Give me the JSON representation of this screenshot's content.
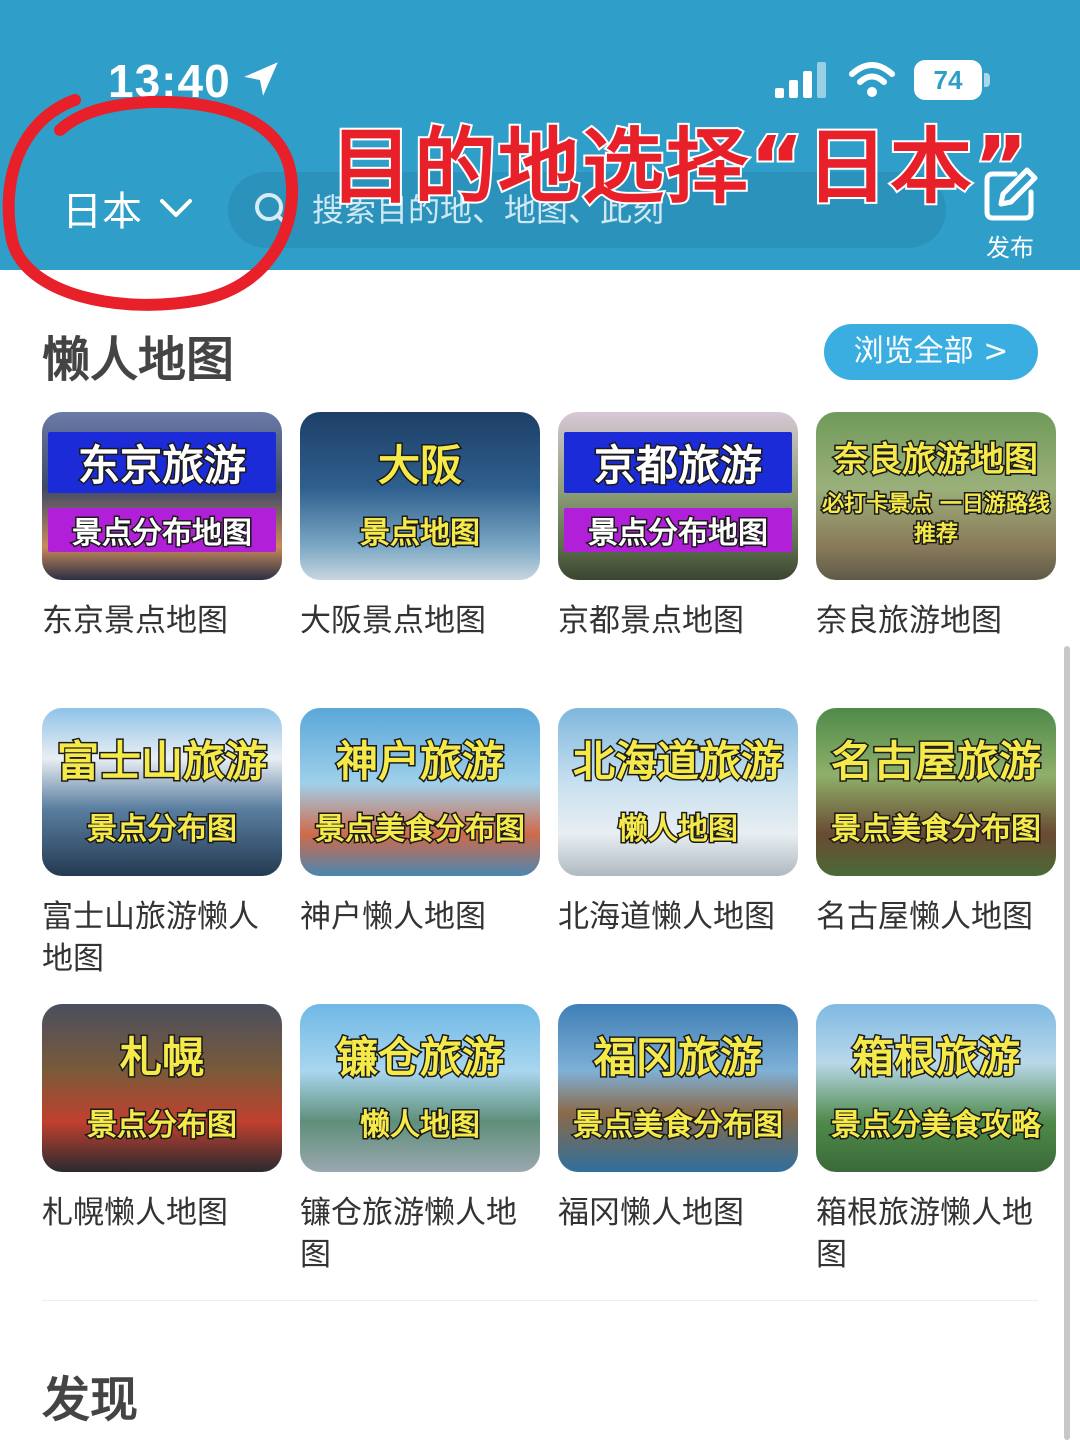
{
  "status_bar": {
    "time": "13:40",
    "battery": "74"
  },
  "annotation": {
    "title": "目的地选择“日本”",
    "highlight_color": "#e8202a"
  },
  "header": {
    "region": "日本",
    "search_placeholder": "搜索目的地、地图、此刻",
    "publish_label": "发布",
    "background": "#2f9fc9"
  },
  "section": {
    "title": "懒人地图",
    "browse_all": "浏览全部 >"
  },
  "maps": [
    {
      "label": "东京景点地图",
      "thumb_title": "东京旅游",
      "thumb_sub": "景点分布地图",
      "style": "bar",
      "bg": "linear-gradient(180deg,#6a7ba8 0%,#3e4868 45%,#c98a5a 80%,#2a2f45 100%)"
    },
    {
      "label": "大阪景点地图",
      "thumb_title": "大阪",
      "thumb_sub": "景点地图",
      "style": "plain",
      "bg": "linear-gradient(180deg,#1d3f66 0%,#2f5f8f 45%,#7ba8c4 80%,#c9d6df 100%)"
    },
    {
      "label": "京都景点地图",
      "thumb_title": "京都旅游",
      "thumb_sub": "景点分布地图",
      "style": "bar",
      "bg": "linear-gradient(180deg,#d8c8d6 0%,#8fa07a 45%,#5c6e4c 80%,#3b4430 100%)"
    },
    {
      "label": "奈良旅游地图",
      "thumb_title": "奈良旅游地图",
      "thumb_sub": "必打卡景点 一日游路线推荐",
      "style": "plain",
      "bg": "linear-gradient(180deg,#6f9a5a 0%,#9bb07a 45%,#8a7a5a 80%,#5e5a48 100%)"
    },
    {
      "label": "富士山旅游懒人地图",
      "thumb_title": "富士山旅游",
      "thumb_sub": "景点分布图",
      "style": "plain",
      "bg": "linear-gradient(180deg,#8fc3e8 0%,#e9eef3 30%,#5a7ea0 60%,#243a52 100%)"
    },
    {
      "label": "神户懒人地图",
      "thumb_title": "神户旅游",
      "thumb_sub": "景点美食分布图",
      "style": "plain",
      "bg": "linear-gradient(180deg,#5aa7d9 0%,#9fd0ea 45%,#d06a4a 75%,#4a86b0 100%)"
    },
    {
      "label": "北海道懒人地图",
      "thumb_title": "北海道旅游",
      "thumb_sub": "懒人地图",
      "style": "plain",
      "bg": "linear-gradient(180deg,#7fb7de 0%,#c8e0ef 45%,#e8eef2 75%,#aeb9c0 100%)"
    },
    {
      "label": "名古屋懒人地图",
      "thumb_title": "名古屋旅游",
      "thumb_sub": "景点美食分布图",
      "style": "plain",
      "bg": "linear-gradient(180deg,#4f8a4a 0%,#8fb06a 40%,#6a4a32 75%,#4a6a38 100%)"
    },
    {
      "label": "札幌懒人地图",
      "thumb_title": "札幌",
      "thumb_sub": "景点分布图",
      "style": "plain",
      "bg": "linear-gradient(180deg,#4a4f5e 0%,#7a5a3a 40%,#c0402e 70%,#2a2a30 100%)"
    },
    {
      "label": "镰仓旅游懒人地图",
      "thumb_title": "镰仓旅游",
      "thumb_sub": "懒人地图",
      "style": "plain",
      "bg": "linear-gradient(180deg,#6fb8e6 0%,#a9d6ef 40%,#5f8f7a 70%,#9aa7b0 100%)"
    },
    {
      "label": "福冈懒人地图",
      "thumb_title": "福冈旅游",
      "thumb_sub": "景点美食分布图",
      "style": "plain",
      "bg": "linear-gradient(180deg,#3f7fb6 0%,#7fb0d6 40%,#8a6a48 65%,#2f6f9e 100%)"
    },
    {
      "label": "箱根旅游懒人地图",
      "thumb_title": "箱根旅游",
      "thumb_sub": "景点分美食攻略",
      "style": "plain",
      "bg": "linear-gradient(180deg,#7fb9e2 0%,#b9d8ea 35%,#4f8a4a 70%,#3a6a38 100%)"
    }
  ],
  "discover": {
    "title": "发现"
  }
}
